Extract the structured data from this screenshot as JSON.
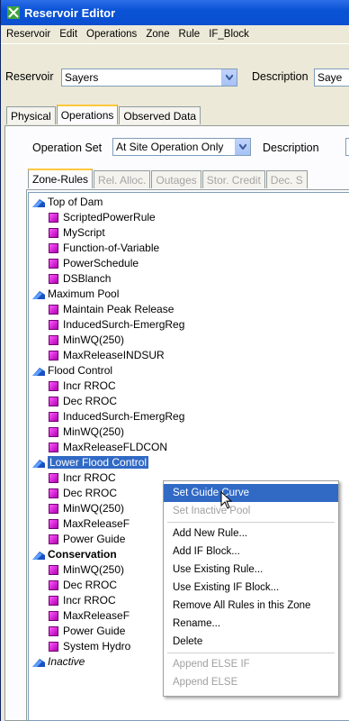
{
  "title": "Reservoir Editor",
  "menubar": [
    "Reservoir",
    "Edit",
    "Operations",
    "Zone",
    "Rule",
    "IF_Block"
  ],
  "reservoir": {
    "label": "Reservoir",
    "value": "Sayers",
    "description_label": "Description",
    "description_value": "Saye"
  },
  "top_tabs": [
    "Physical",
    "Operations",
    "Observed Data"
  ],
  "operation_set": {
    "label": "Operation Set",
    "value": "At Site Operation Only",
    "description_label": "Description"
  },
  "sub_tabs": [
    "Zone-Rules",
    "Rel. Alloc.",
    "Outages",
    "Stor. Credit",
    "Dec. S"
  ],
  "tree": [
    {
      "zone": "Top of Dam",
      "rules": [
        "ScriptedPowerRule",
        "MyScript",
        "Function-of-Variable",
        "PowerSchedule",
        "DSBlanch"
      ]
    },
    {
      "zone": "Maximum Pool",
      "rules": [
        "Maintain Peak Release",
        "InducedSurch-EmergReg",
        "MinWQ(250)",
        "MaxReleaseINDSUR"
      ]
    },
    {
      "zone": "Flood Control",
      "rules": [
        "Incr RROC",
        "Dec RROC",
        "InducedSurch-EmergReg",
        "MinWQ(250)",
        "MaxReleaseFLDCON"
      ]
    },
    {
      "zone": "Lower Flood Control",
      "rules": [
        "Incr RROC",
        "Dec RROC",
        "MinWQ(250)",
        "MaxReleaseF",
        "Power Guide"
      ]
    },
    {
      "zone": "Conservation",
      "rules": [
        "MinWQ(250)",
        "Dec RROC",
        "Incr RROC",
        "MaxReleaseF",
        "Power Guide",
        "System Hydro"
      ]
    },
    {
      "zone": "Inactive",
      "rules": []
    }
  ],
  "context_menu": [
    "Set Guide Curve",
    "Set Inactive Pool",
    "Add New Rule...",
    "Add IF Block...",
    "Use Existing Rule...",
    "Use Existing IF Block...",
    "Remove All Rules in this Zone",
    "Rename...",
    "Delete",
    "Append ELSE IF",
    "Append ELSE"
  ],
  "colors": {
    "title_bar": "#0a53d6",
    "selection": "#316ac5",
    "rule_icon": "#e020e0",
    "active_tab_accent": "#ffc83c"
  }
}
